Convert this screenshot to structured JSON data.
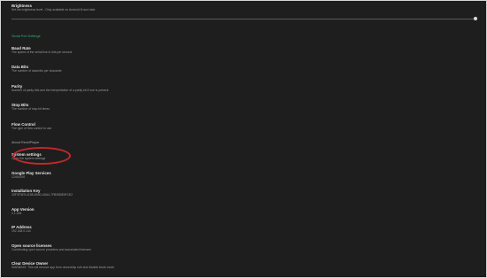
{
  "brightness": {
    "title": "Brightness",
    "subtitle": "Set the brightness level - Only available on Android M and later",
    "value": 1.0
  },
  "serial_section": {
    "header": "Serial Port Settings",
    "items": [
      {
        "title": "Baud Rate",
        "subtitle": "The speed of the serial line in bits per second"
      },
      {
        "title": "Data Bits",
        "subtitle": "The number of data bits per character"
      },
      {
        "title": "Parity",
        "subtitle": "Number of parity bits and the interpretation of a parity bit if one is present"
      },
      {
        "title": "Stop Bits",
        "subtitle": "The number of stop bit times"
      },
      {
        "title": "Flow Control",
        "subtitle": "The type of flow control to use"
      }
    ]
  },
  "about_section": {
    "header": "About RevelPlayer",
    "items": [
      {
        "title": "System settings",
        "subtitle": "Open the system settings"
      },
      {
        "title": "Google Play Services",
        "subtitle": "12451000"
      },
      {
        "title": "Installation Key",
        "subtitle": "33F3F3E5-4158-4B50-A5A4-7FB0BBE5F1E2"
      },
      {
        "title": "App Version",
        "subtitle": "2.1.253"
      },
      {
        "title": "IP Address",
        "subtitle": "192.168.0.144"
      },
      {
        "title": "Open source licenses",
        "subtitle": "Contributing open source providers and associated licenses"
      },
      {
        "title": "Clear Device Owner",
        "subtitle": "WARNING: This will remove app from ownership role and disable kiosk mode"
      }
    ]
  },
  "colors": {
    "background": "#1e1e1e",
    "accent": "#2bb673",
    "annotation": "#c0282d"
  }
}
